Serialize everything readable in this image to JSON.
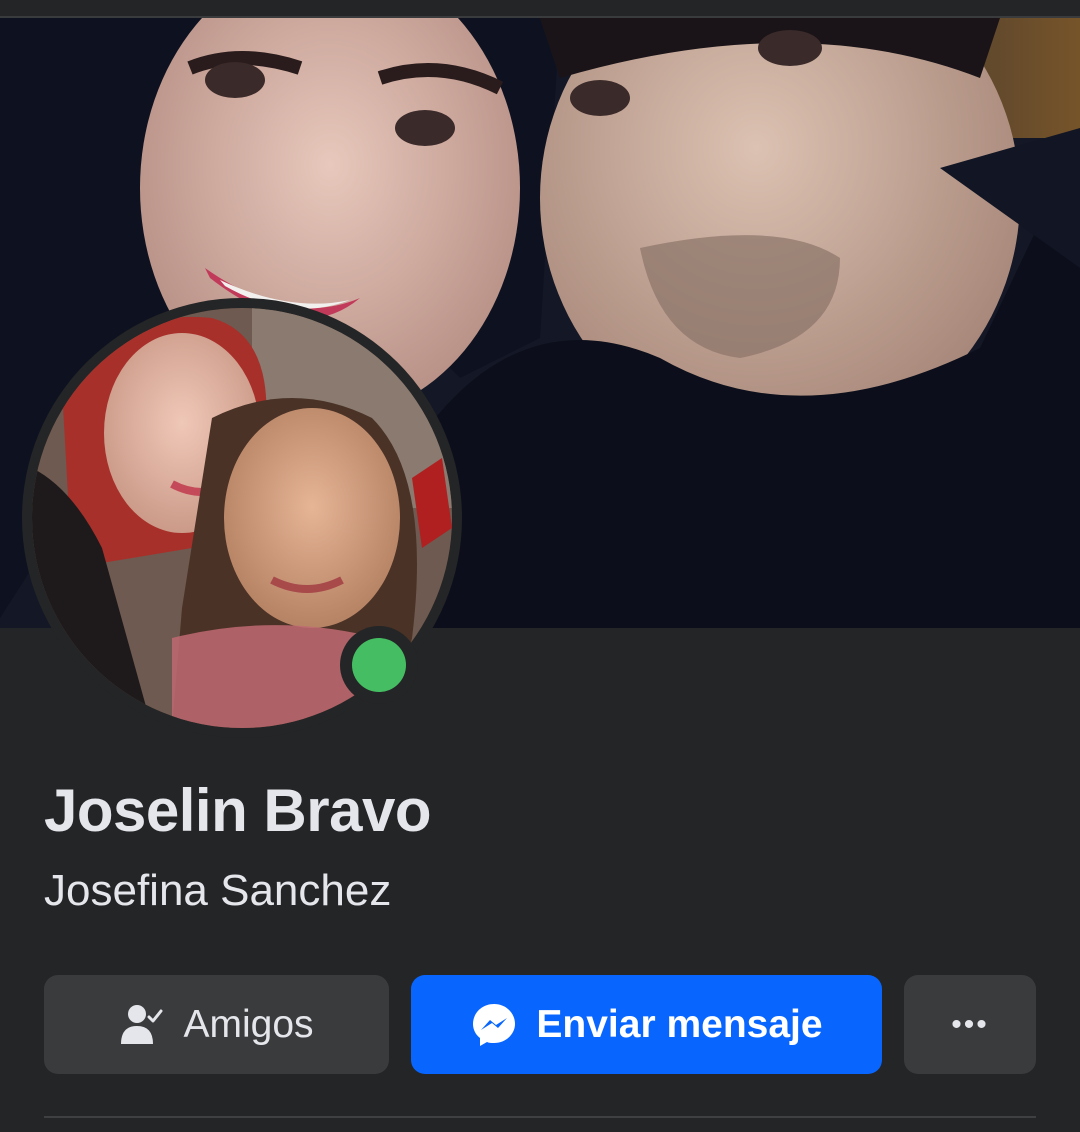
{
  "profile": {
    "name": "Joselin Bravo",
    "alternate_name": "Josefina Sanchez",
    "online": true
  },
  "actions": {
    "friends_label": "Amigos",
    "message_label": "Enviar mensaje",
    "more_label": "•••"
  },
  "colors": {
    "background": "#242526",
    "button_secondary": "#3a3b3c",
    "button_primary": "#0866ff",
    "online": "#45bd62",
    "text": "#e4e6eb"
  },
  "icons": {
    "friends": "person-check-icon",
    "message": "messenger-icon",
    "more": "more-dots-icon"
  }
}
